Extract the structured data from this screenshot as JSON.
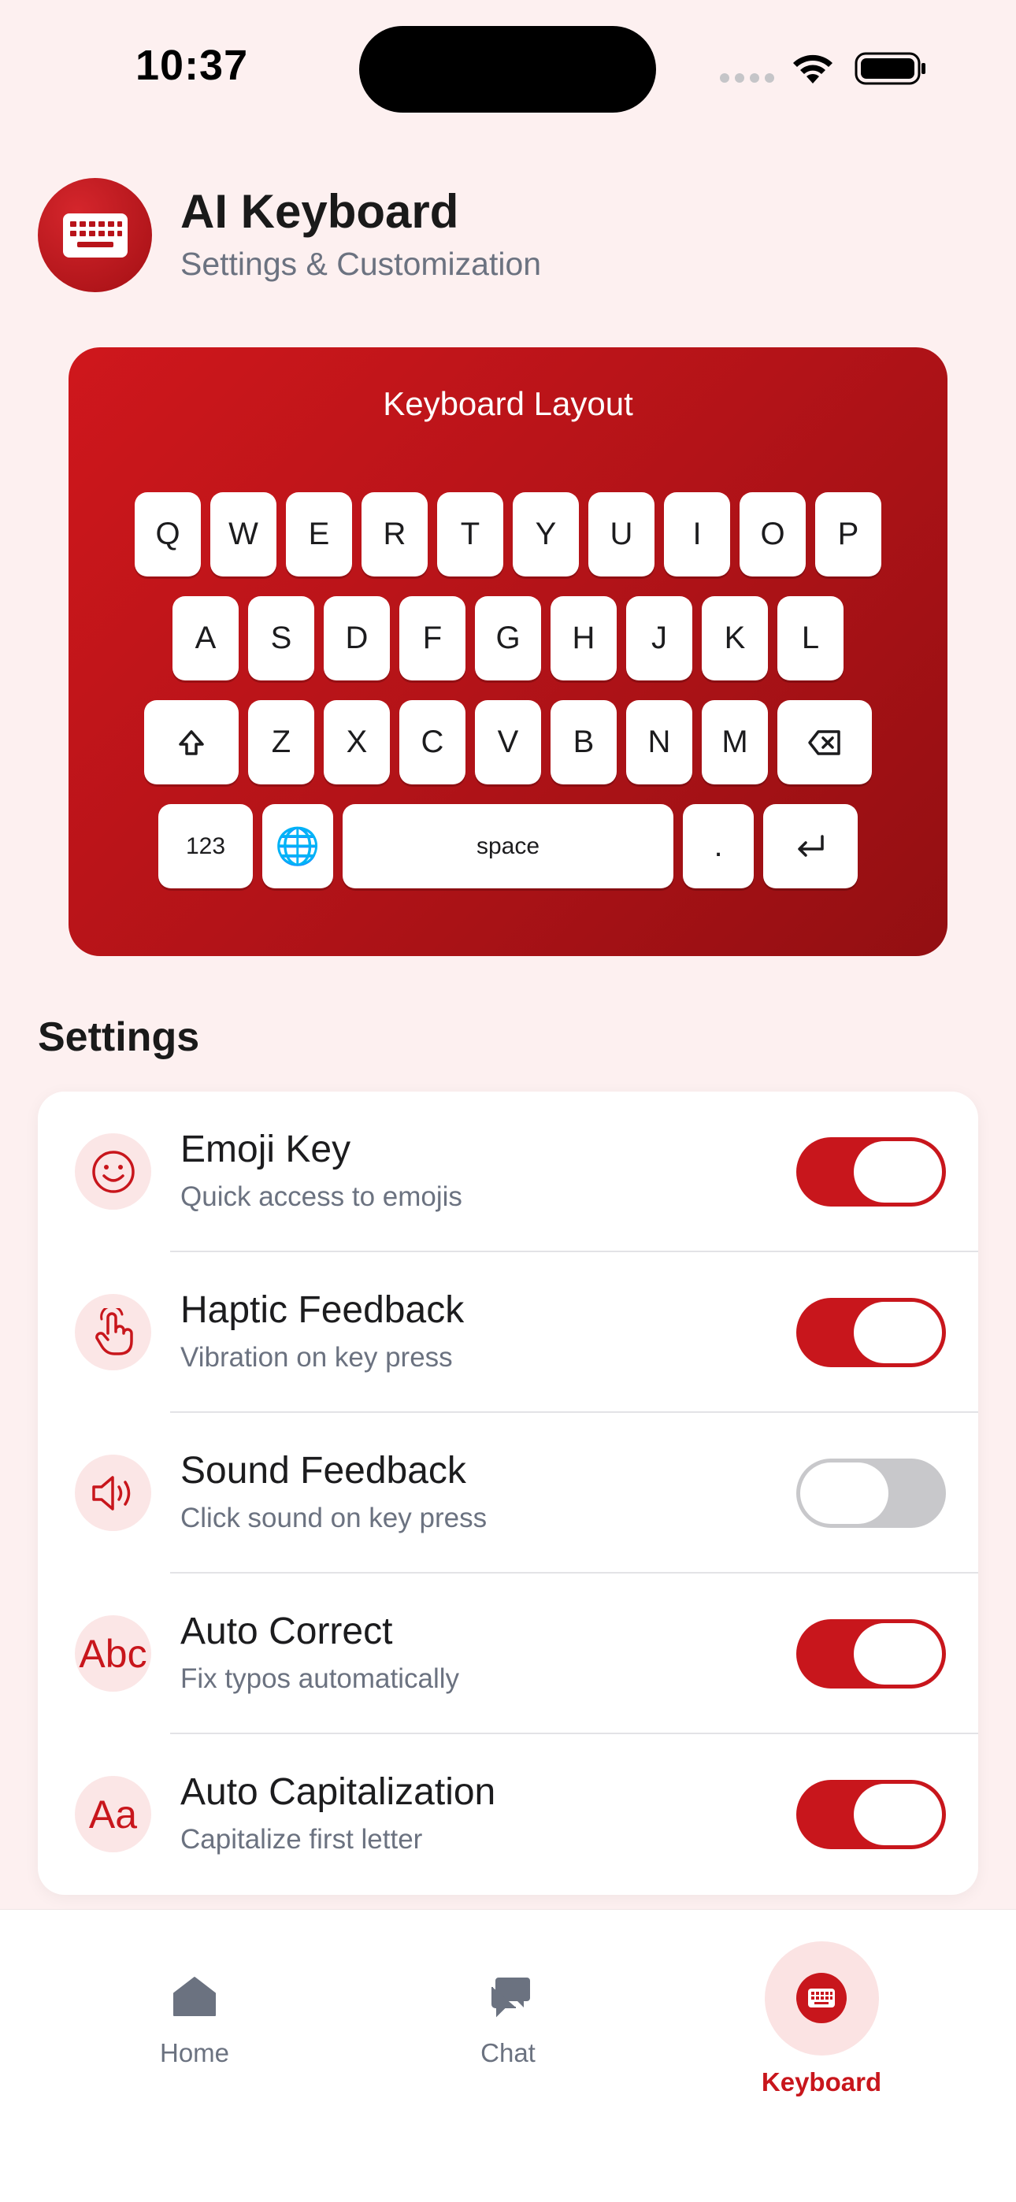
{
  "status_bar": {
    "time": "10:37"
  },
  "header": {
    "title": "AI Keyboard",
    "subtitle": "Settings & Customization"
  },
  "keyboard_preview": {
    "title": "Keyboard Layout",
    "row1": [
      "Q",
      "W",
      "E",
      "R",
      "T",
      "Y",
      "U",
      "I",
      "O",
      "P"
    ],
    "row2": [
      "A",
      "S",
      "D",
      "F",
      "G",
      "H",
      "J",
      "K",
      "L"
    ],
    "row3": [
      "Z",
      "X",
      "C",
      "V",
      "B",
      "N",
      "M"
    ],
    "numbers_key": "123",
    "globe_key": "🌐",
    "space_key": "space",
    "period_key": "."
  },
  "settings": {
    "heading": "Settings",
    "items": [
      {
        "title": "Emoji Key",
        "description": "Quick access to emojis",
        "icon": "smiley-icon",
        "enabled": true
      },
      {
        "title": "Haptic Feedback",
        "description": "Vibration on key press",
        "icon": "tap-hand-icon",
        "enabled": true
      },
      {
        "title": "Sound Feedback",
        "description": "Click sound on key press",
        "icon": "speaker-icon",
        "enabled": false
      },
      {
        "title": "Auto Correct",
        "description": "Fix typos automatically",
        "icon_text": "Abc",
        "enabled": true
      },
      {
        "title": "Auto Capitalization",
        "description": "Capitalize first letter",
        "icon_text": "Aa",
        "enabled": true
      }
    ]
  },
  "bottom_nav": {
    "home": "Home",
    "chat": "Chat",
    "keyboard": "Keyboard",
    "active": "keyboard"
  },
  "colors": {
    "accent": "#c8161c",
    "background": "#fdf0f0",
    "muted_text": "#6b7280"
  }
}
